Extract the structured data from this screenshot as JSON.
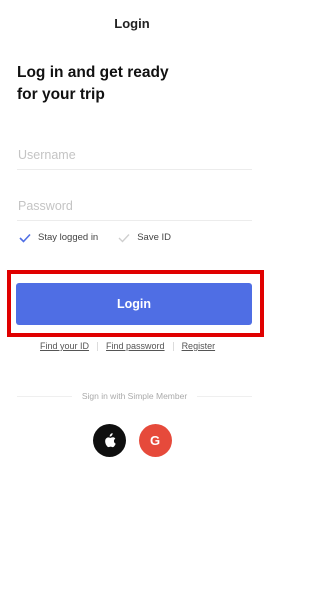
{
  "header": {
    "title": "Login"
  },
  "headline": {
    "line1": "Log in and get ready",
    "line2": "for your trip"
  },
  "form": {
    "username_placeholder": "Username",
    "password_placeholder": "Password",
    "stay_logged_in": {
      "label": "Stay logged in",
      "checked": true
    },
    "save_id": {
      "label": "Save ID",
      "checked": false
    },
    "login_button": "Login"
  },
  "links": {
    "find_id": "Find your ID",
    "find_password": "Find password",
    "register": "Register"
  },
  "social": {
    "divider_text": "Sign in with Simple Member",
    "google_glyph": "G",
    "buttons": [
      {
        "name": "apple",
        "icon": "apple-icon",
        "color": "#0f0f0f"
      },
      {
        "name": "google",
        "icon": "google-icon",
        "color": "#e64a3b"
      }
    ]
  },
  "colors": {
    "primary": "#4f6ee4",
    "highlight": "#e00000"
  }
}
